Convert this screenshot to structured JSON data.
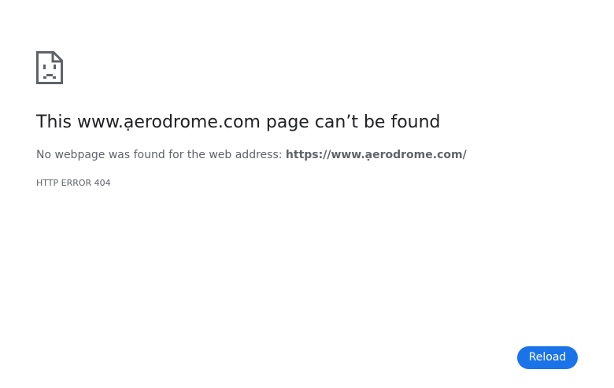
{
  "error": {
    "icon": "sad-page-icon",
    "title_prefix": "This ",
    "title_host": "www.ạerodrome.com",
    "title_suffix": " page can’t be found",
    "message_prefix": "No webpage was found for the web address: ",
    "url": "https://www.ạerodrome.com/",
    "code": "HTTP ERROR 404"
  },
  "actions": {
    "reload_label": "Reload"
  },
  "colors": {
    "accent": "#1a73e8",
    "text_primary": "#202124",
    "text_secondary": "#5f6368",
    "icon": "#5f6368"
  }
}
